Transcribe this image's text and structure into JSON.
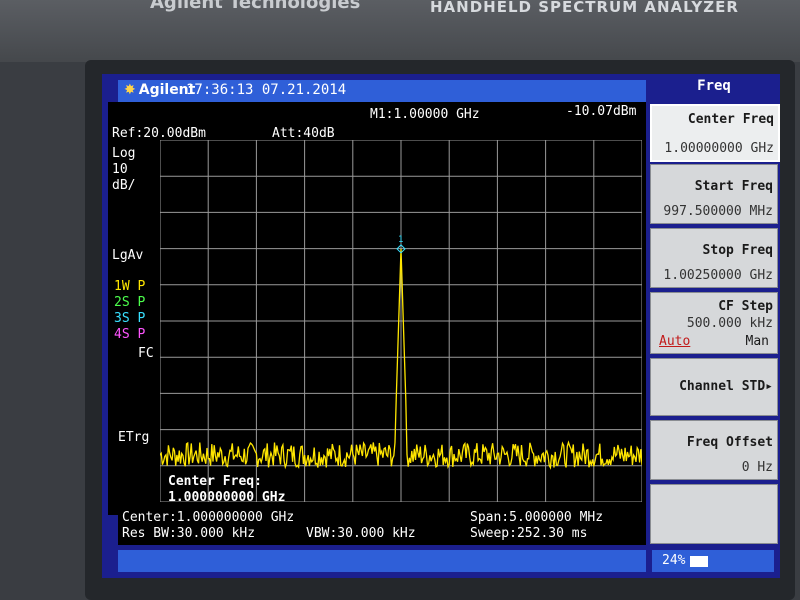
{
  "device": {
    "brand_top": "Agilent Technologies",
    "model_top": "HANDHELD SPECTRUM ANALYZER"
  },
  "titlebar": {
    "logo": "Agilent",
    "timestamp": "17:36:13 07.21.2014"
  },
  "menu": {
    "title": "Freq"
  },
  "display": {
    "ref": "Ref:20.00dBm",
    "att": "Att:40dB",
    "marker_label": "M1:1.00000 GHz",
    "marker_value": "-10.07dBm",
    "scale_mode": "Log",
    "scale_step": "10",
    "scale_unit": "dB/",
    "avg_mode": "LgAv",
    "traces": [
      {
        "label": "1W P",
        "color": "#ffe600"
      },
      {
        "label": "2S P",
        "color": "#4cff4c"
      },
      {
        "label": "3S P",
        "color": "#38e0ff"
      },
      {
        "label": "4S P",
        "color": "#ff55ff"
      }
    ],
    "fc": "FC",
    "etrg": "ETrg",
    "entry_label": "Center Freq:",
    "entry_value": "1.000000000 GHz"
  },
  "footer": {
    "center": "Center:1.000000000 GHz",
    "span": "Span:5.000000 MHz",
    "res_bw": "Res BW:30.000 kHz",
    "vbw": "VBW:30.000 kHz",
    "sweep": "Sweep:252.30 ms"
  },
  "softkeys": {
    "center_freq": {
      "label": "Center Freq",
      "value": "1.00000000 GHz"
    },
    "start_freq": {
      "label": "Start Freq",
      "value": "997.500000 MHz"
    },
    "stop_freq": {
      "label": "Stop Freq",
      "value": "1.00250000 GHz"
    },
    "cf_step": {
      "label": "CF Step",
      "value": "500.000 kHz",
      "auto": "Auto",
      "man": "Man"
    },
    "channel_std": {
      "label": "Channel STD"
    },
    "freq_offset": {
      "label": "Freq Offset",
      "value": "0 Hz"
    }
  },
  "status": {
    "battery": "24%"
  },
  "colors": {
    "trace": "#ffe600",
    "screen_bg": "#1b1f8e",
    "title_bg": "#2f5fd8",
    "grid": "#9a9a9a",
    "marker": "#38e0ff"
  },
  "chart_data": {
    "type": "line",
    "title": "",
    "xlabel": "",
    "ylabel": "",
    "x_center_ghz": 1.0,
    "x_span_mhz": 5.0,
    "xlim_mhz": [
      997.5,
      1002.5
    ],
    "ylim_dbm": [
      -80,
      20
    ],
    "grid": true,
    "noise_floor_dbm": -67,
    "series": [
      {
        "name": "1W P",
        "peak_x_mhz": 1000.0,
        "peak_y_dbm": -10.07
      }
    ],
    "marker": {
      "label": "1",
      "x_mhz": 1000.0,
      "y_dbm": -10.07
    }
  }
}
